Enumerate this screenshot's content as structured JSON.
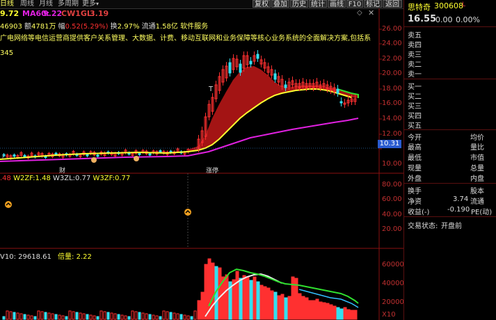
{
  "toolbar": {
    "periods": [
      "日线",
      "周线",
      "月线",
      "多周期",
      "更多"
    ],
    "buttons": [
      "复权",
      "叠加",
      "历史",
      "统计",
      "画线",
      "F10",
      "标记",
      "返回"
    ]
  },
  "indicators_top": {
    "ma_a": "9.72",
    "ma60_label": "MA60:",
    "ma60": "9.22",
    "cw_label": "CW1GL:",
    "cw": "3.19"
  },
  "info_bar": {
    "vol": "46903",
    "amount_label": "额",
    "amount": "4781万",
    "amp_label": "幅",
    "amp": "0.52(5.29%)",
    "turn_label": "换",
    "turn": "2.97%",
    "float_label": "流通",
    "float": "1.58亿",
    "sector": "软件服务"
  },
  "description": "广电网络等电信运营商提供客户关系管理、大数据、计费、移动互联网和业务保障等核心业务系统的全面解决方案,包括系",
  "small_label": "345",
  "price_axis": [
    "26.00",
    "24.00",
    "22.00",
    "20.00",
    "18.00",
    "16.00",
    "14.00",
    "12.00",
    "10.00"
  ],
  "current_price_tag": "10.31",
  "chart_marks": {
    "finance": "财",
    "limit": "涨停",
    "t_mark": "T"
  },
  "panel2": {
    "a_label": ".48",
    "w2_label": "W2ZF:",
    "w2": "1.48",
    "w3_label": "W3ZL:",
    "w3": "0.77",
    "w3zf_label": "W3ZF:",
    "w3zf": "0.77",
    "axis": [
      "80.00",
      "60.00",
      "40.00",
      "20.00"
    ]
  },
  "volume_panel": {
    "label": "V10:",
    "value": "29618.61",
    "ratio_label": "倍量:",
    "ratio": "2.22",
    "axis": [
      "60000",
      "40000",
      "20000"
    ],
    "unit": "X10"
  },
  "stock": {
    "name": "思特奇",
    "code": "300608",
    "flag": "L",
    "price": "16.55",
    "change": "0.00",
    "change_pct": "0.00%"
  },
  "order_book": {
    "sell": [
      "卖五",
      "卖四",
      "卖三",
      "卖二",
      "卖一"
    ],
    "buy": [
      "买一",
      "买二",
      "买三",
      "买四",
      "买五"
    ]
  },
  "quote_rows": [
    [
      "今开",
      "均价"
    ],
    [
      "最高",
      "量比"
    ],
    [
      "最低",
      "市值"
    ],
    [
      "现量",
      "总量"
    ],
    [
      "外盘",
      "内盘"
    ]
  ],
  "extra_rows": {
    "turnover_label": "换手",
    "equity_label": "股本",
    "net_asset_label": "净资",
    "net_asset": "3.74",
    "float_label": "流通",
    "eps_label": "收益(-)",
    "eps": "-0.190",
    "pe_label": "PE(动)"
  },
  "trade_status": {
    "label": "交易状态:",
    "value": "开盘前"
  },
  "colors": {
    "up": "#ff3030",
    "down": "#33e0f0",
    "ma60": "#e020e0",
    "yellow": "#ffff30",
    "green": "#30e030"
  }
}
